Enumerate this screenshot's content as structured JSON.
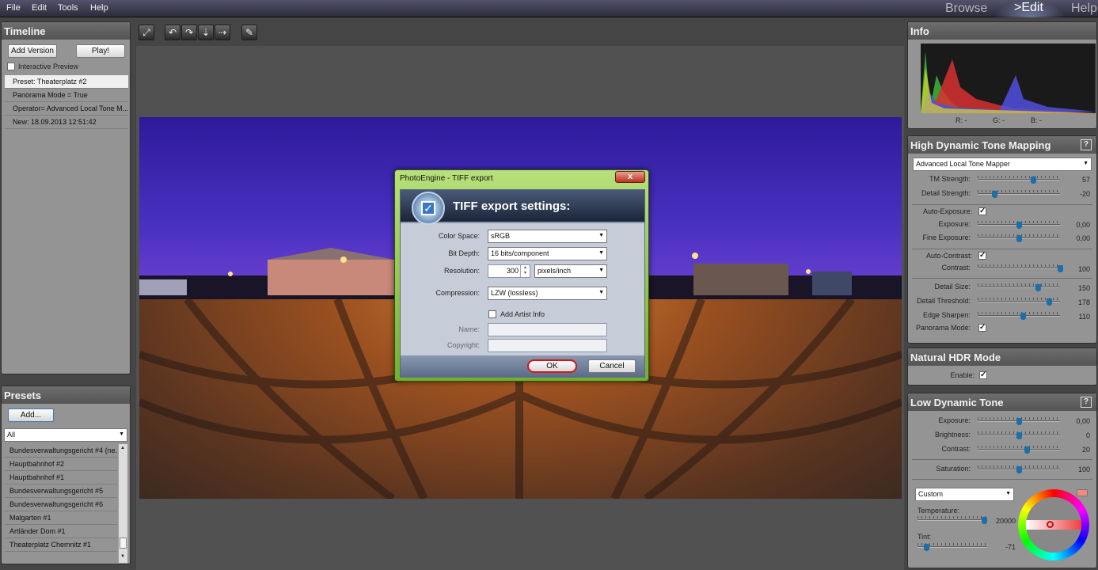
{
  "menu": {
    "file": "File",
    "edit": "Edit",
    "tools": "Tools",
    "help": "Help"
  },
  "modes": {
    "browse": "Browse",
    "edit": ">Edit",
    "help": "Help"
  },
  "timeline": {
    "title": "Timeline",
    "add_version": "Add Version",
    "play": "Play!",
    "interactive_preview": "Interactive Preview",
    "items": [
      "Preset: Theaterplatz #2",
      "Panorama Mode = True",
      "Operator= Advanced Local Tone M...",
      "New: 18.09.2013 12:51:42"
    ]
  },
  "presets": {
    "title": "Presets",
    "add": "Add...",
    "filter": "All",
    "items": [
      "Bundesverwaltungsgericht #4 (ne...",
      "Hauptbahnhof #2",
      "Hauptbahnhof #1",
      "Bundesverwaltungsgericht #5",
      "Bundesverwaltungsgericht #6",
      "Malgarten #1",
      "Artländer Dom #1",
      "Theaterplatz Chemnitz #1"
    ]
  },
  "toolbar": {
    "icons": [
      "fit-screen-icon",
      "rotate-left-icon",
      "rotate-right-icon",
      "flip-vertical-icon",
      "flip-horizontal-icon",
      "eyedropper-icon"
    ]
  },
  "info": {
    "title": "Info",
    "r": "R: -",
    "g": "G: -",
    "b": "B: -"
  },
  "hdr": {
    "title": "High Dynamic Tone Mapping",
    "help": "?",
    "operator": "Advanced Local Tone Mapper",
    "tm_strength": {
      "label": "TM Strength:",
      "value": "57",
      "level": 0.67
    },
    "detail_strength": {
      "label": "Detail Strength:",
      "value": "-20",
      "level": 0.2
    },
    "auto_exposure": "Auto-Exposure:",
    "exposure": {
      "label": "Exposure:",
      "value": "0,00",
      "level": 0.5
    },
    "fine_exposure": {
      "label": "Fine Exposure:",
      "value": "0,00",
      "level": 0.5
    },
    "auto_contrast": "Auto-Contrast:",
    "contrast": {
      "label": "Contrast:",
      "value": "100",
      "level": 1.0
    },
    "detail_size": {
      "label": "Detail Size:",
      "value": "150",
      "level": 0.73
    },
    "detail_threshold": {
      "label": "Detail Threshold:",
      "value": "178",
      "level": 0.87
    },
    "edge_sharpen": {
      "label": "Edge Sharpen:",
      "value": "110",
      "level": 0.55
    },
    "panorama_mode": "Panorama Mode:"
  },
  "natural": {
    "title": "Natural HDR Mode",
    "enable": "Enable:"
  },
  "ldt": {
    "title": "Low Dynamic Tone",
    "help": "?",
    "exposure": {
      "label": "Exposure:",
      "value": "0,00",
      "level": 0.5
    },
    "brightness": {
      "label": "Brightness:",
      "value": "0",
      "level": 0.5
    },
    "contrast": {
      "label": "Contrast:",
      "value": "20",
      "level": 0.6
    },
    "saturation": {
      "label": "Saturation:",
      "value": "100",
      "level": 0.5
    },
    "white_balance": "Custom",
    "temperature": {
      "label": "Temperature:",
      "value": "20000",
      "level": 0.95
    },
    "tint": {
      "label": "Tint:",
      "value": "-71",
      "level": 0.12
    }
  },
  "dialog": {
    "window_title": "PhotoEngine - TIFF export",
    "close": "x",
    "header": "TIFF export settings:",
    "color_space_label": "Color Space:",
    "color_space": "sRGB",
    "bit_depth_label": "Bit Depth:",
    "bit_depth": "16 bits/component",
    "resolution_label": "Resolution:",
    "resolution": "300",
    "resolution_unit": "pixels/inch",
    "compression_label": "Compression:",
    "compression": "LZW (lossless)",
    "add_artist": "Add Artist Info",
    "name_label": "Name:",
    "copyright_label": "Copyright:",
    "ok": "OK",
    "cancel": "Cancel"
  },
  "colors": {
    "accent": "#1e6ea8",
    "dialog_frame": "#8cc34a",
    "ok_highlight": "#d01818"
  }
}
